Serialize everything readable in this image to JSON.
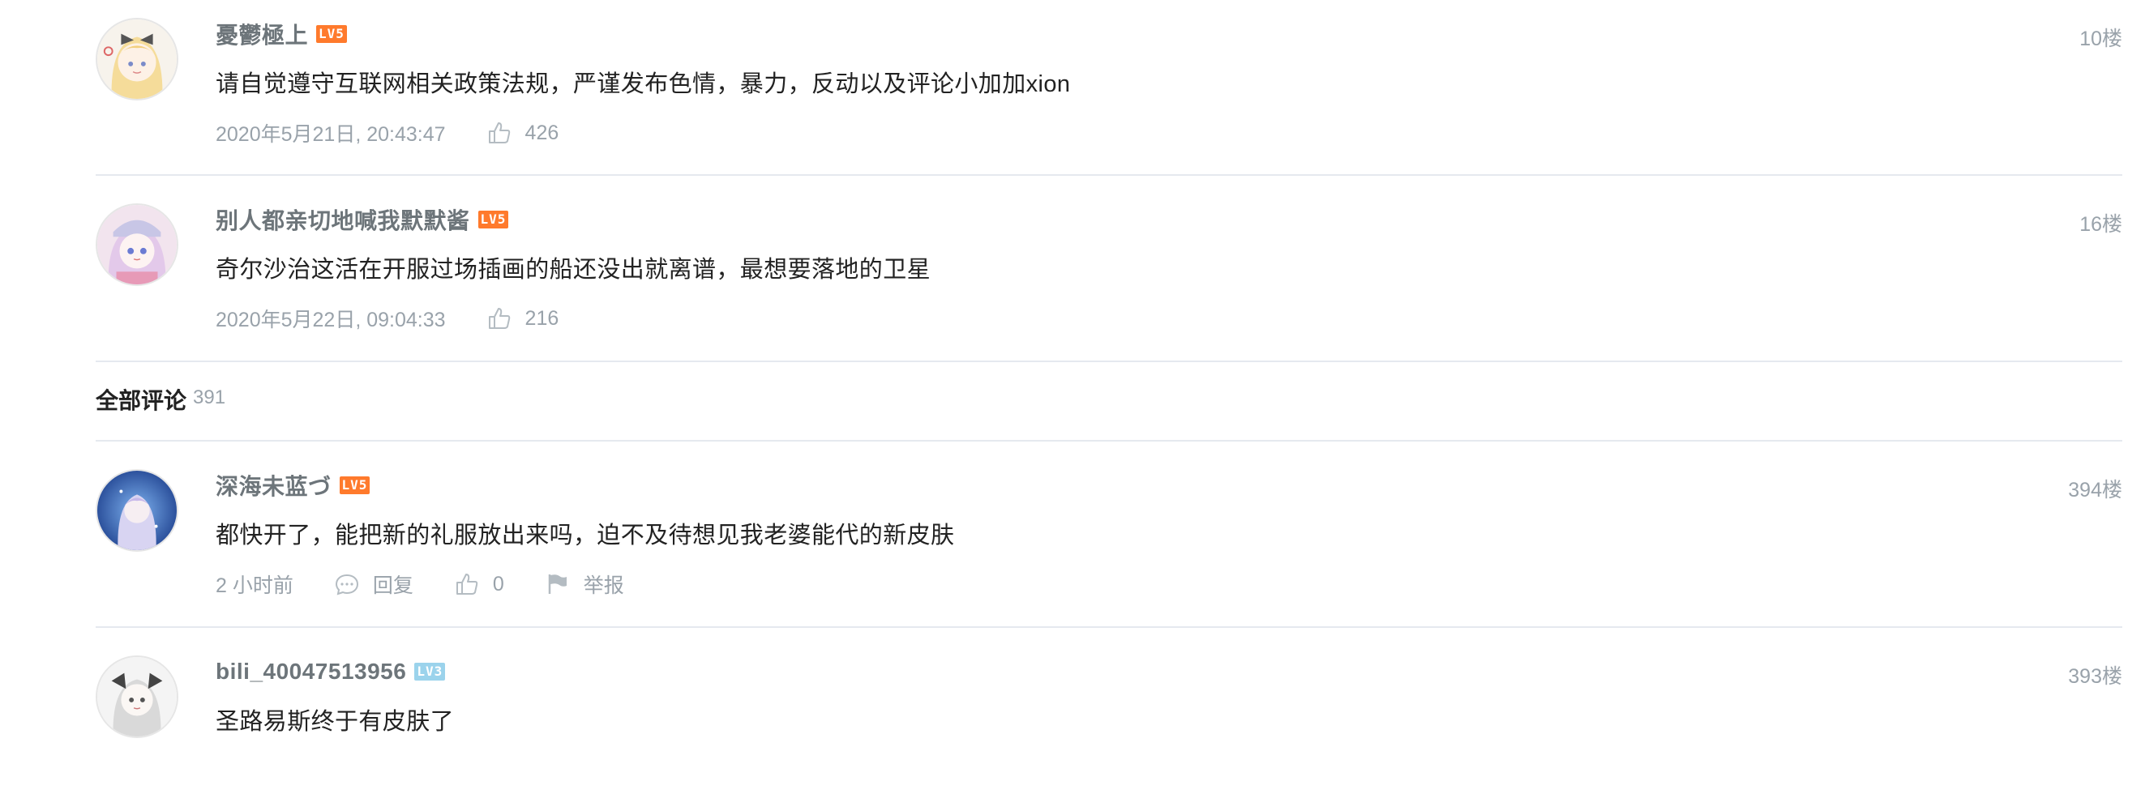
{
  "hot_comments": [
    {
      "username": "憂鬱極上",
      "level": "LV5",
      "floor": "10楼",
      "text": "请自觉遵守互联网相关政策法规，严谨发布色情，暴力，反动以及评论小加加xion",
      "time": "2020年5月21日, 20:43:47",
      "likes": "426"
    },
    {
      "username": "别人都亲切地喊我默默酱",
      "level": "LV5",
      "floor": "16楼",
      "text": "奇尔沙治这活在开服过场插画的船还没出就离谱，最想要落地的卫星",
      "time": "2020年5月22日, 09:04:33",
      "likes": "216"
    }
  ],
  "all_comments_section": {
    "title": "全部评论",
    "count": "391"
  },
  "comments": [
    {
      "username": "深海未蓝づ",
      "level": "LV5",
      "floor": "394楼",
      "text": "都快开了，能把新的礼服放出来吗，迫不及待想见我老婆能代的新皮肤",
      "time": "2 小时前",
      "reply_label": "回复",
      "likes": "0",
      "report_label": "举报"
    },
    {
      "username": "bili_40047513956",
      "level": "LV3",
      "floor": "393楼",
      "text": "圣路易斯终于有皮肤了"
    }
  ],
  "icons": {
    "like": "thumbs-up-icon",
    "reply": "speech-bubble-icon",
    "report": "flag-icon"
  },
  "colors": {
    "username": "#6d757a",
    "meta": "#99a2aa",
    "level_lv5": "#ff7a2c",
    "level_lv3": "#9bd3ec",
    "divider": "#e5e9ef"
  }
}
